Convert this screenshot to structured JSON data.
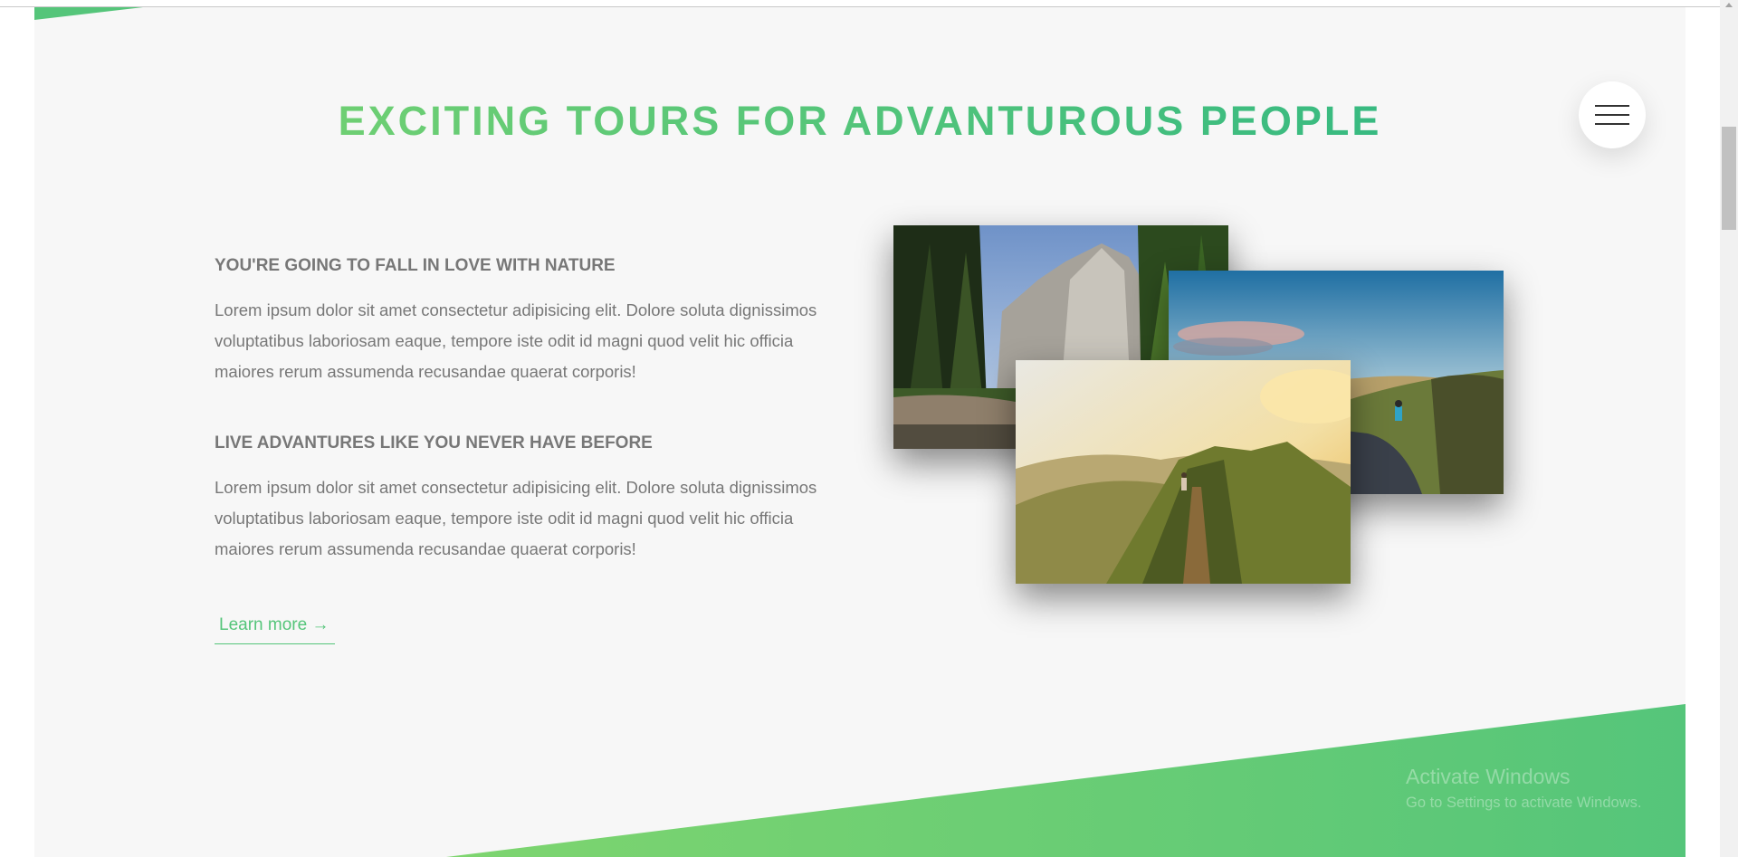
{
  "section": {
    "title_prefix": "EXCITING TOURS FOR ",
    "title_emphasis": "ADVANTUROUS PEOPLE"
  },
  "menu": {
    "icon": "hamburger-menu-icon"
  },
  "features": [
    {
      "heading": "YOU'RE GOING TO FALL IN LOVE WITH NATURE",
      "text": "Lorem ipsum dolor sit amet consectetur adipisicing elit. Dolore soluta dignissimos voluptatibus laboriosam eaque, tempore iste odit id magni quod velit hic officia maiores rerum assumenda recusandae quaerat corporis!"
    },
    {
      "heading": "LIVE ADVANTURES LIKE YOU NEVER HAVE BEFORE",
      "text": "Lorem ipsum dolor sit amet consectetur adipisicing elit. Dolore soluta dignissimos voluptatibus laboriosam eaque, tempore iste odit id magni quod velit hic officia maiores rerum assumenda recusandae quaerat corporis!"
    }
  ],
  "cta": {
    "label": "Learn more →"
  },
  "watermark": {
    "title": "Activate Windows",
    "subtitle": "Go to Settings to activate Windows."
  },
  "colors": {
    "green_light": "#7ed56f",
    "green_dark": "#28b485",
    "green_primary": "#55c57a",
    "text_grey": "#777777",
    "background": "#f7f7f7"
  }
}
